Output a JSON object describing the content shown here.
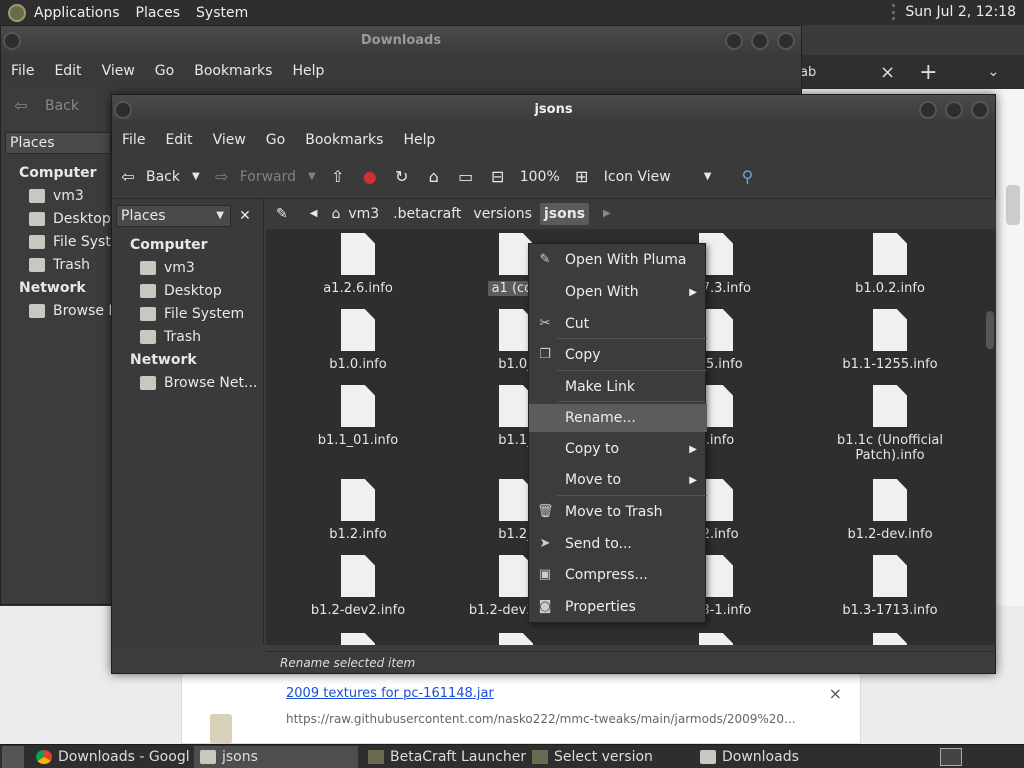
{
  "top_panel": {
    "menus": [
      "Applications",
      "Places",
      "System"
    ],
    "clock": "Sun Jul  2, 12:18"
  },
  "back_window": {
    "title": "Downloads",
    "menus": [
      "File",
      "Edit",
      "View",
      "Go",
      "Bookmarks",
      "Help"
    ],
    "back_label": "Back",
    "places_label": "Places",
    "sidebar": {
      "computer": "Computer",
      "items": [
        "vm3",
        "Desktop",
        "File Syster",
        "Trash"
      ],
      "network": "Network",
      "browse": "Browse Ne"
    }
  },
  "chrome": {
    "tab_fragment": "ab",
    "close": "×",
    "new_tab": "+",
    "menu": "⌄"
  },
  "download": {
    "link": "2009 textures for pc-161148.jar",
    "url": "https://raw.githubusercontent.com/nasko222/mmc-tweaks/main/jarmods/2009%20...",
    "close": "×"
  },
  "front_window": {
    "title": "jsons",
    "menus": [
      "File",
      "Edit",
      "View",
      "Go",
      "Bookmarks",
      "Help"
    ],
    "toolbar": {
      "back": "Back",
      "forward": "Forward",
      "zoom": "100%",
      "view_mode": "Icon View"
    },
    "places_label": "Places",
    "sidebar": {
      "computer": "Computer",
      "items": [
        "vm3",
        "Desktop",
        "File System",
        "Trash"
      ],
      "network": "Network",
      "browse": "Browse Net..."
    },
    "path": [
      "vm3",
      ".betacraft",
      "versions",
      "jsons"
    ],
    "files": [
      "a1.2.6.info",
      "a1 (cop",
      "b1.7.3.info",
      "b1.0.2.info",
      "b1.0.info",
      "b1.0_",
      "245.info",
      "b1.1-1255.info",
      "b1.1_01.info",
      "b1.1_",
      "a.info",
      "b1.1c (Unofficial Patch).info",
      "b1.2.info",
      "b1.2_",
      "02.info",
      "b1.2-dev.info",
      "b1.2-dev2.info",
      "b1.2-dev3.info",
      "b1.3-1.info",
      "b1.3-1713.info"
    ],
    "status": "Rename selected item"
  },
  "context_menu": [
    {
      "label": "Open With Pluma",
      "icon": "pluma-icon",
      "glyph": "✎"
    },
    {
      "label": "Open With",
      "icon": "",
      "glyph": "",
      "submenu": true
    },
    {
      "label": "Cut",
      "icon": "scissors-icon",
      "glyph": "✂"
    },
    {
      "label": "Copy",
      "icon": "copy-icon",
      "glyph": "❐"
    },
    {
      "label": "Make Link",
      "icon": "",
      "glyph": ""
    },
    {
      "label": "Rename...",
      "icon": "",
      "glyph": "",
      "highlight": true
    },
    {
      "label": "Copy to",
      "icon": "",
      "glyph": "",
      "submenu": true
    },
    {
      "label": "Move to",
      "icon": "",
      "glyph": "",
      "submenu": true
    },
    {
      "label": "Move to Trash",
      "icon": "trash-icon",
      "glyph": "🗑"
    },
    {
      "label": "Send to...",
      "icon": "send-icon",
      "glyph": "➤"
    },
    {
      "label": "Compress...",
      "icon": "archive-icon",
      "glyph": "▣"
    },
    {
      "label": "Properties",
      "icon": "properties-icon",
      "glyph": "◙"
    }
  ],
  "taskbar": [
    {
      "label": "Downloads - Googl...",
      "active": false
    },
    {
      "label": "jsons",
      "active": true
    },
    {
      "label": "BetaCraft Launcher ...",
      "active": false
    },
    {
      "label": "Select version",
      "active": false
    },
    {
      "label": "Downloads",
      "active": false
    }
  ]
}
